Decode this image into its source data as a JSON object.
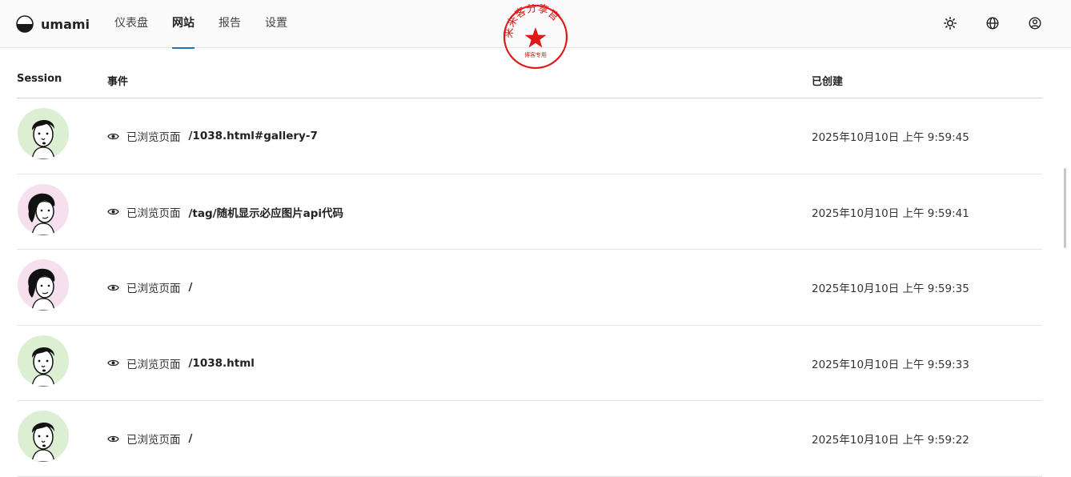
{
  "app": {
    "name": "umami"
  },
  "nav": [
    {
      "label": "仪表盘",
      "active": false
    },
    {
      "label": "网站",
      "active": true
    },
    {
      "label": "报告",
      "active": false
    },
    {
      "label": "设置",
      "active": false
    }
  ],
  "header_icons": [
    "sun-icon",
    "globe-icon",
    "user-circle-icon"
  ],
  "stamp": {
    "ring_text": "来来客分享官",
    "inner_text": "博客专用",
    "color": "#e01818"
  },
  "table": {
    "columns": {
      "session": "Session",
      "event": "事件",
      "created": "已创建"
    },
    "rows": [
      {
        "avatar": "male-green",
        "event_type": "已浏览页面",
        "path": "/1038.html#gallery-7",
        "created": "2025年10月10日 上午 9:59:45"
      },
      {
        "avatar": "female-pink",
        "event_type": "已浏览页面",
        "path": "/tag/随机显示必应图片api代码",
        "created": "2025年10月10日 上午 9:59:41"
      },
      {
        "avatar": "female-pink",
        "event_type": "已浏览页面",
        "path": "/",
        "created": "2025年10月10日 上午 9:59:35"
      },
      {
        "avatar": "male-green",
        "event_type": "已浏览页面",
        "path": "/1038.html",
        "created": "2025年10月10日 上午 9:59:33"
      },
      {
        "avatar": "male-green",
        "event_type": "已浏览页面",
        "path": "/",
        "created": "2025年10月10日 上午 9:59:22"
      }
    ]
  },
  "colors": {
    "accent": "#2a6fb5",
    "avatar_green": "#dcefd2",
    "avatar_pink": "#f6e0ee"
  }
}
